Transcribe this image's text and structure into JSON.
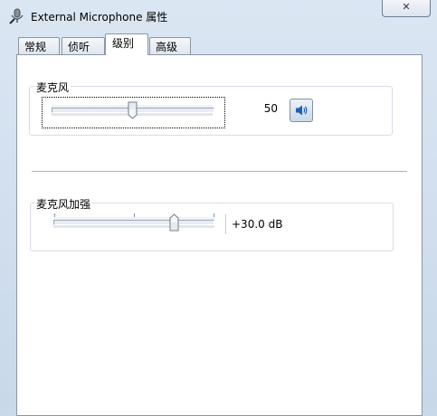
{
  "window": {
    "title": "External Microphone 属性",
    "close_label": "✕",
    "accent": "#3a82d6"
  },
  "tabs": [
    {
      "label": "常规"
    },
    {
      "label": "侦听"
    },
    {
      "label": "级别"
    },
    {
      "label": "高级"
    }
  ],
  "active_tab": "级别",
  "microphone": {
    "label": "麦克风",
    "value": "50",
    "level": 0.5,
    "mute_icon": "speaker-icon"
  },
  "boost": {
    "label": "麦克风加强",
    "value": "+30.0 dB",
    "level": 0.75
  }
}
